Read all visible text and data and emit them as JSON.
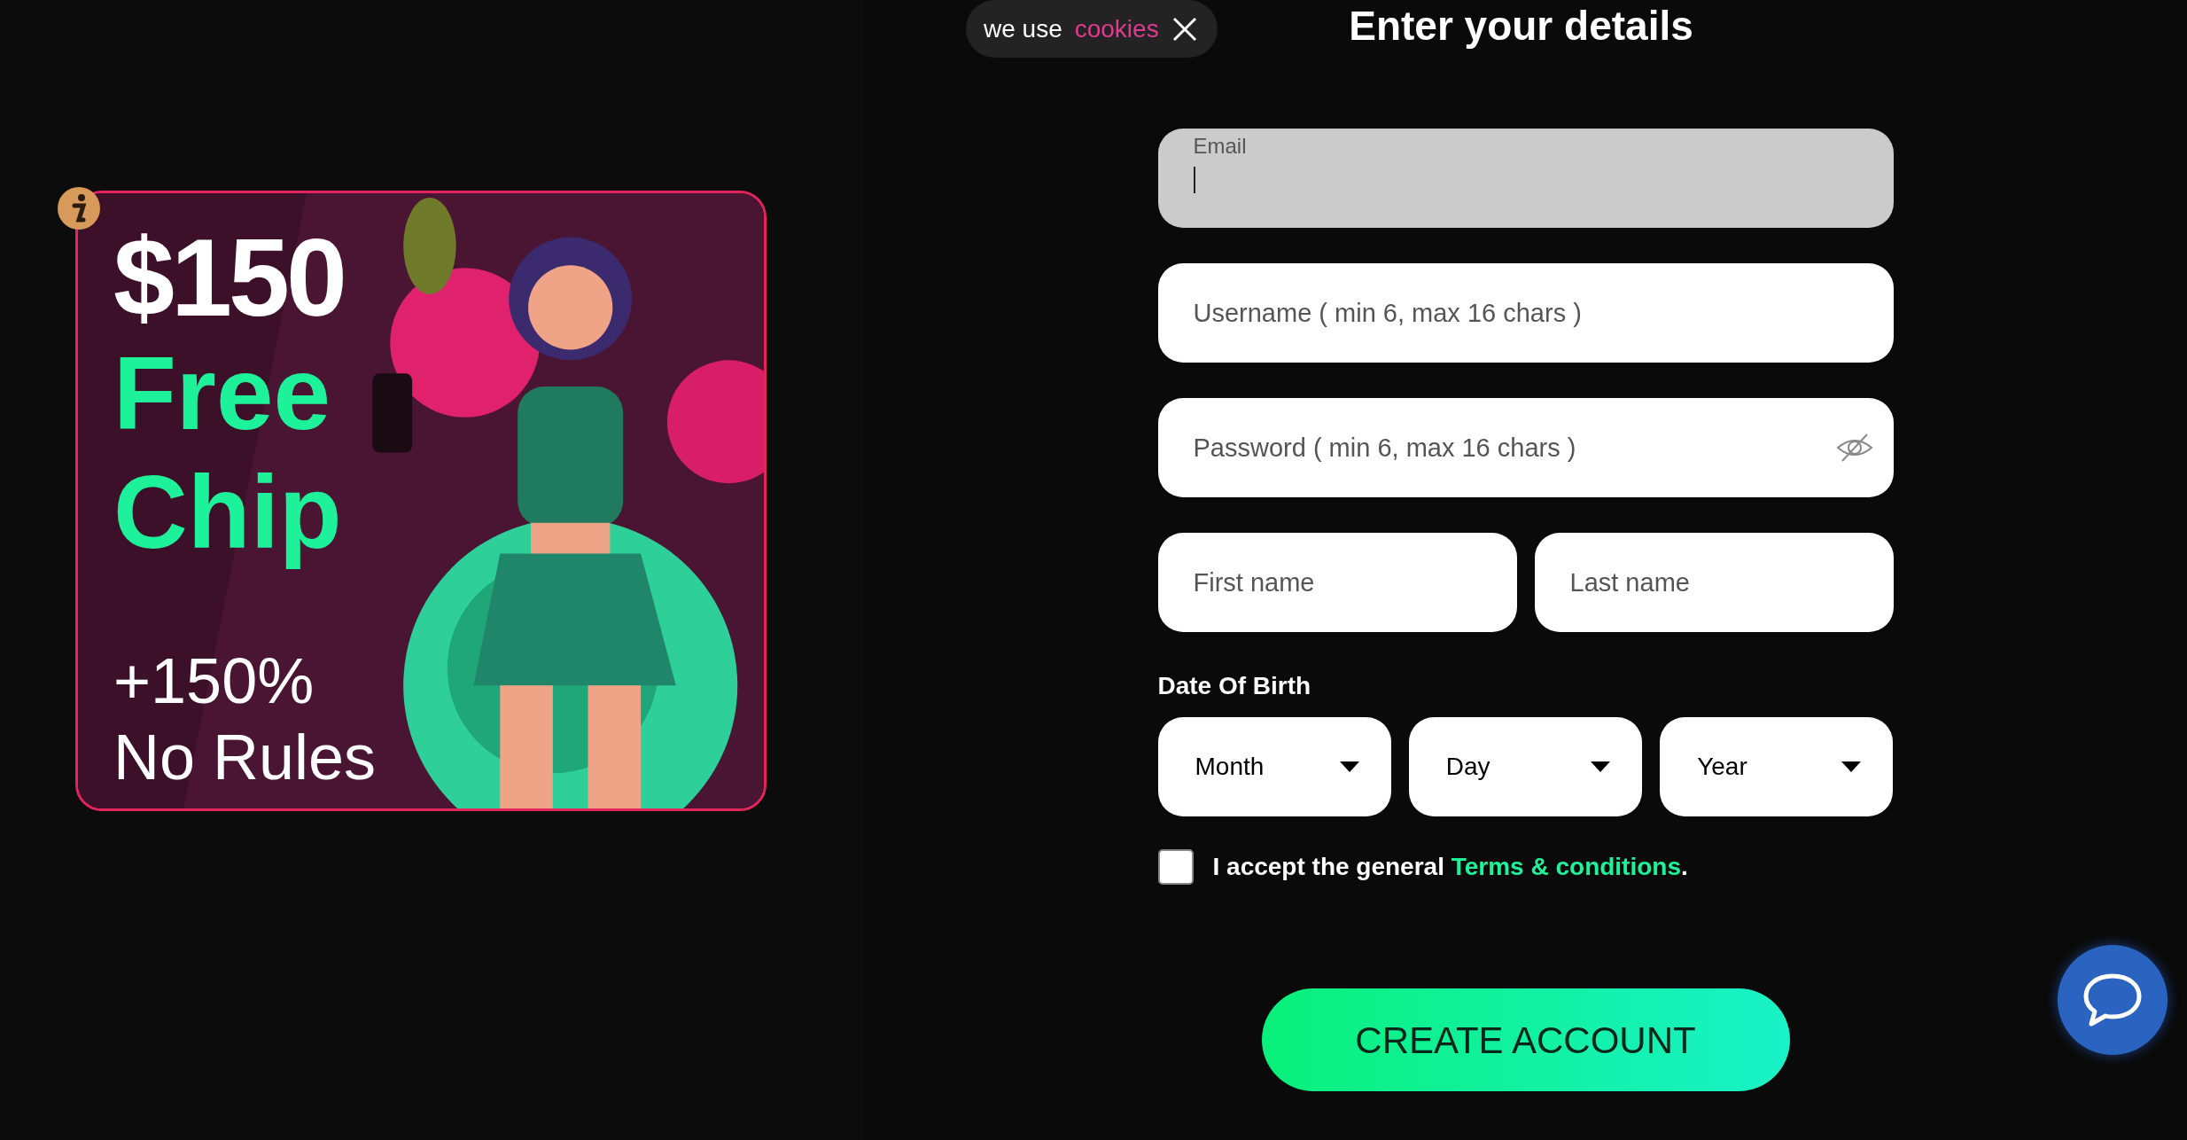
{
  "cookie_notice": {
    "text": "we use",
    "link": "cookies"
  },
  "promo": {
    "lines": [
      {
        "text": "$150",
        "kind": "amount"
      },
      {
        "text": "Free",
        "kind": "highlight"
      },
      {
        "text": "Chip",
        "kind": "highlight"
      },
      {
        "text": "+150%",
        "kind": "detail"
      },
      {
        "text": "No Rules",
        "kind": "detail"
      }
    ]
  },
  "title": "Enter your details",
  "fields": [
    {
      "kind": "text",
      "label": "Email",
      "focused": true
    },
    {
      "kind": "text",
      "placeholder": "Username ( min 6, max 16 chars )",
      "focused": false
    },
    {
      "kind": "password",
      "placeholder": "Password ( min 6, max 16 chars )",
      "focused": false
    }
  ],
  "name_fields": [
    {
      "placeholder": "First name"
    },
    {
      "placeholder": "Last name"
    }
  ],
  "date_of_birth": {
    "label": "Date Of Birth",
    "selects": [
      "Month",
      "Day",
      "Year"
    ]
  },
  "terms": {
    "checked": false,
    "text": "I accept the general ",
    "link": "Terms & conditions",
    "end": "."
  },
  "submit": "CREATE ACCOUNT"
}
